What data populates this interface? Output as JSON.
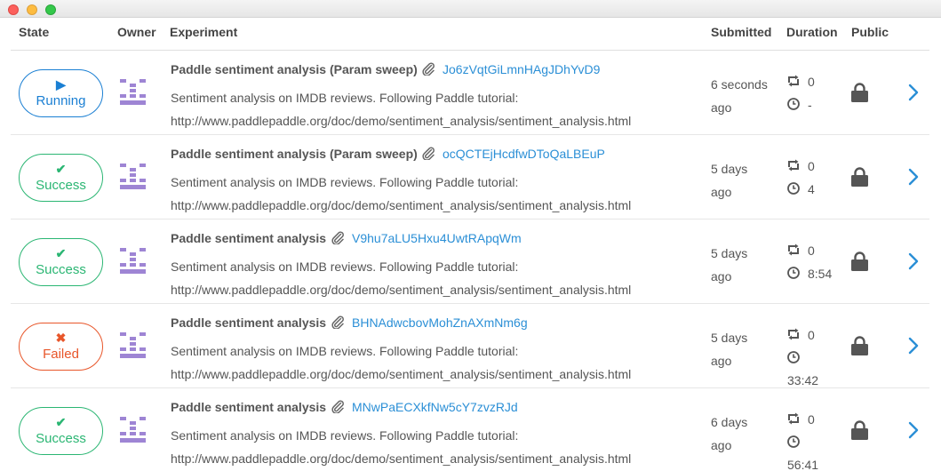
{
  "header": {
    "state": "State",
    "owner": "Owner",
    "experiment": "Experiment",
    "submitted": "Submitted",
    "duration": "Duration",
    "public": "Public"
  },
  "colors": {
    "running": "#1a7fd3",
    "success": "#2bb673",
    "failed": "#e8562a",
    "link": "#2b8fd6",
    "owner_avatar": "#9e85d4"
  },
  "rows": [
    {
      "state": "Running",
      "state_icon": "play-icon",
      "title": "Paddle sentiment analysis (Param sweep)",
      "id": "Jo6zVqtGiLmnHAgJDhYvD9",
      "desc1": "Sentiment analysis on IMDB reviews. Following Paddle tutorial:",
      "desc2": "http://www.paddlepaddle.org/doc/demo/sentiment_analysis/sentiment_analysis.html",
      "submitted1": "6 seconds",
      "submitted2": "ago",
      "retries": "0",
      "duration": "-"
    },
    {
      "state": "Success",
      "state_icon": "check-icon",
      "title": "Paddle sentiment analysis (Param sweep)",
      "id": "ocQCTEjHcdfwDToQaLBEuP",
      "desc1": "Sentiment analysis on IMDB reviews. Following Paddle tutorial:",
      "desc2": "http://www.paddlepaddle.org/doc/demo/sentiment_analysis/sentiment_analysis.html",
      "submitted1": "5 days",
      "submitted2": "ago",
      "retries": "0",
      "duration": "4"
    },
    {
      "state": "Success",
      "state_icon": "check-icon",
      "title": "Paddle sentiment analysis",
      "id": "V9hu7aLU5Hxu4UwtRApqWm",
      "desc1": "Sentiment analysis on IMDB reviews. Following Paddle tutorial:",
      "desc2": "http://www.paddlepaddle.org/doc/demo/sentiment_analysis/sentiment_analysis.html",
      "submitted1": "5 days",
      "submitted2": "ago",
      "retries": "0",
      "duration": "8:54"
    },
    {
      "state": "Failed",
      "state_icon": "x-icon",
      "title": "Paddle sentiment analysis",
      "id": "BHNAdwcbovMohZnAXmNm6g",
      "desc1": "Sentiment analysis on IMDB reviews. Following Paddle tutorial:",
      "desc2": "http://www.paddlepaddle.org/doc/demo/sentiment_analysis/sentiment_analysis.html",
      "submitted1": "5 days",
      "submitted2": "ago",
      "retries": "0",
      "duration": "33:42"
    },
    {
      "state": "Success",
      "state_icon": "check-icon",
      "title": "Paddle sentiment analysis",
      "id": "MNwPaECXkfNw5cY7zvzRJd",
      "desc1": "Sentiment analysis on IMDB reviews. Following Paddle tutorial:",
      "desc2": "http://www.paddlepaddle.org/doc/demo/sentiment_analysis/sentiment_analysis.html",
      "submitted1": "6 days",
      "submitted2": "ago",
      "retries": "0",
      "duration": "56:41"
    }
  ]
}
